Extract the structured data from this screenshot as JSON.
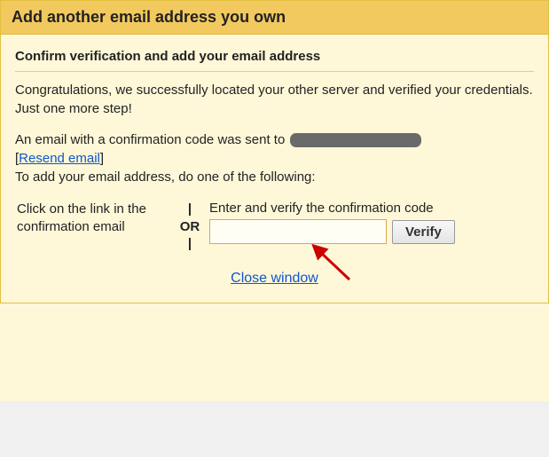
{
  "header": {
    "title": "Add another email address you own"
  },
  "subtitle": "Confirm verification and add your email address",
  "congrats": "Congratulations, we successfully located your other server and verified your credentials. Just one more step!",
  "confirmation": {
    "sent_prefix": "An email with a confirmation code was sent to ",
    "bracket_open": "[",
    "resend_label": "Resend email",
    "bracket_close": "]",
    "instructions": "To add your email address, do one of the following:"
  },
  "options": {
    "left": "Click on the link in the confirmation email",
    "or_top": "|",
    "or_mid": "OR",
    "or_bot": "|",
    "right_label": "Enter and verify the confirmation code",
    "verify_button": "Verify"
  },
  "close_label": "Close window"
}
